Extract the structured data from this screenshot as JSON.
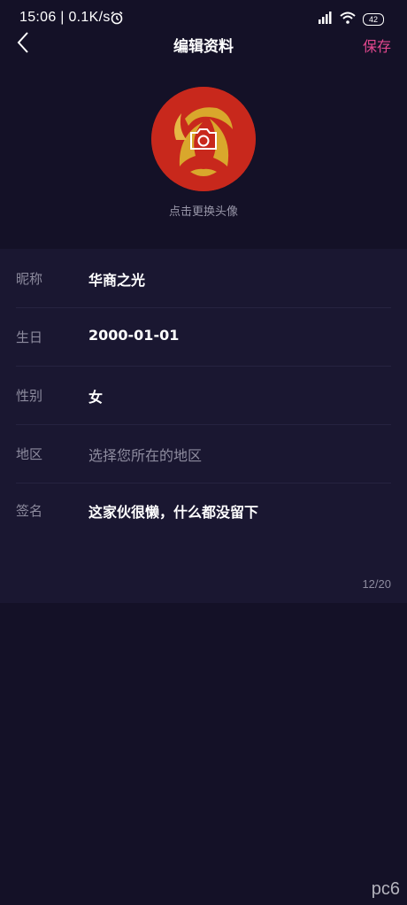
{
  "status_bar": {
    "time": "15:06 | 0.1K/s",
    "battery": "42"
  },
  "nav": {
    "title": "编辑资料",
    "save_label": "保存"
  },
  "avatar": {
    "caption": "点击更换头像"
  },
  "form": {
    "rows": [
      {
        "label": "昵称",
        "value": "华商之光"
      },
      {
        "label": "生日",
        "value": "2000-01-01"
      },
      {
        "label": "性别",
        "value": "女"
      },
      {
        "label": "地区",
        "value": "选择您所在的地区"
      },
      {
        "label": "签名",
        "value": "这家伙很懒，什么都没留下"
      }
    ],
    "char_count": "12/20"
  },
  "watermark": {
    "text": "pc6"
  },
  "colors": {
    "background": "#141127",
    "panel": "#1a1731",
    "accent": "#e3488f"
  }
}
